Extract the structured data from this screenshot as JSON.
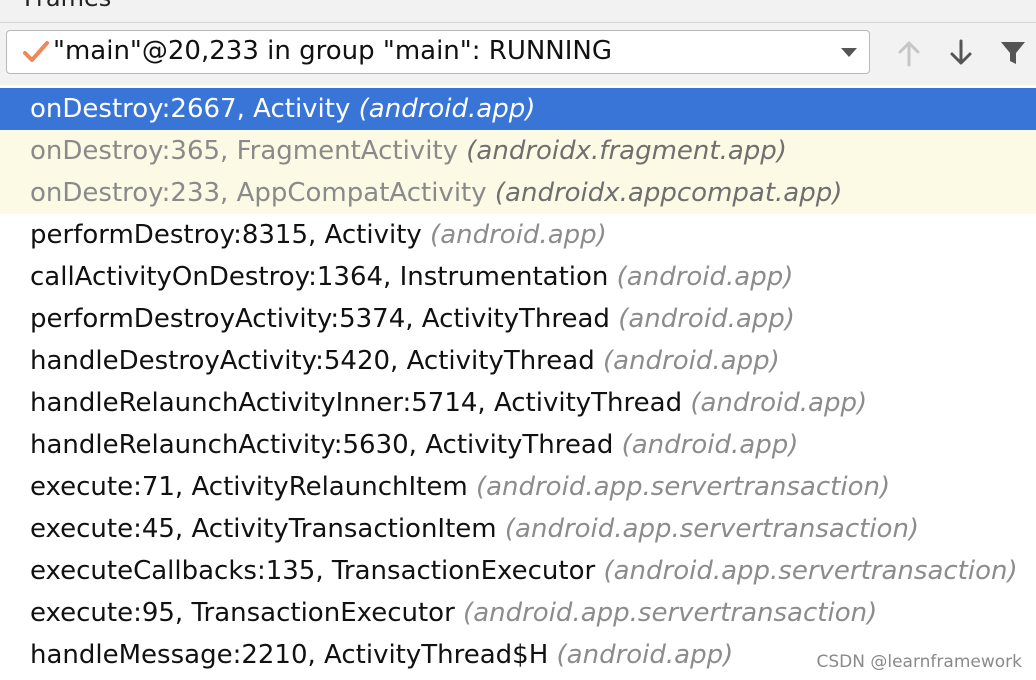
{
  "panel": {
    "title": "Frames"
  },
  "thread_selector": {
    "value": "\"main\"@20,233 in group \"main\": RUNNING",
    "status_icon": "check-icon",
    "dropdown_icon": "chevron-down-icon"
  },
  "toolbar": {
    "buttons": [
      {
        "name": "previous-frame",
        "icon": "arrow-up-icon",
        "enabled": false
      },
      {
        "name": "next-frame",
        "icon": "arrow-down-icon",
        "enabled": true
      },
      {
        "name": "filter",
        "icon": "filter-icon",
        "enabled": true
      }
    ]
  },
  "frames": [
    {
      "method": "onDestroy:2667, Activity",
      "package": "(android.app)",
      "state": "selected"
    },
    {
      "method": "onDestroy:365, FragmentActivity",
      "package": "(androidx.fragment.app)",
      "state": "library"
    },
    {
      "method": "onDestroy:233, AppCompatActivity",
      "package": "(androidx.appcompat.app)",
      "state": "library"
    },
    {
      "method": "performDestroy:8315, Activity",
      "package": "(android.app)",
      "state": "normal"
    },
    {
      "method": "callActivityOnDestroy:1364, Instrumentation",
      "package": "(android.app)",
      "state": "normal"
    },
    {
      "method": "performDestroyActivity:5374, ActivityThread",
      "package": "(android.app)",
      "state": "normal"
    },
    {
      "method": "handleDestroyActivity:5420, ActivityThread",
      "package": "(android.app)",
      "state": "normal"
    },
    {
      "method": "handleRelaunchActivityInner:5714, ActivityThread",
      "package": "(android.app)",
      "state": "normal"
    },
    {
      "method": "handleRelaunchActivity:5630, ActivityThread",
      "package": "(android.app)",
      "state": "normal"
    },
    {
      "method": "execute:71, ActivityRelaunchItem",
      "package": "(android.app.servertransaction)",
      "state": "normal"
    },
    {
      "method": "execute:45, ActivityTransactionItem",
      "package": "(android.app.servertransaction)",
      "state": "normal"
    },
    {
      "method": "executeCallbacks:135, TransactionExecutor",
      "package": "(android.app.servertransaction)",
      "state": "normal"
    },
    {
      "method": "execute:95, TransactionExecutor",
      "package": "(android.app.servertransaction)",
      "state": "normal"
    },
    {
      "method": "handleMessage:2210, ActivityThread$H",
      "package": "(android.app)",
      "state": "normal"
    }
  ],
  "watermark": "CSDN @learnframework",
  "colors": {
    "selection": "#3875d7",
    "library_row": "#fcfae4",
    "check": "#f0885a"
  }
}
